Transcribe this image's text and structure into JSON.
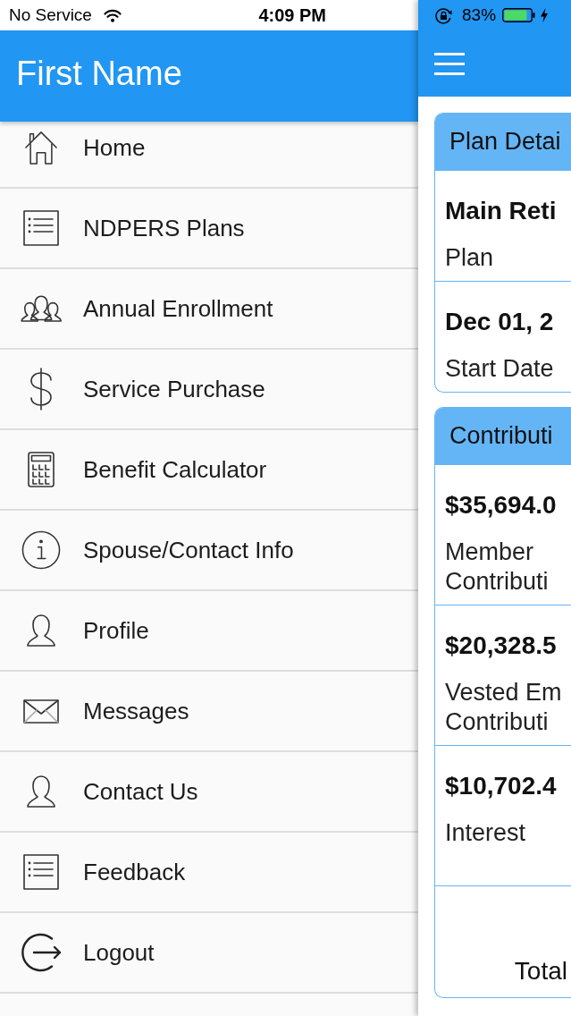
{
  "status_bar": {
    "carrier": "No Service",
    "time": "4:09 PM",
    "battery": "83%"
  },
  "drawer": {
    "title": "First Name",
    "items": [
      {
        "label": "Home",
        "kind": "home"
      },
      {
        "label": "NDPERS Plans",
        "kind": "list"
      },
      {
        "label": "Annual Enrollment",
        "kind": "people"
      },
      {
        "label": "Service Purchase",
        "kind": "dollar"
      },
      {
        "label": "Benefit Calculator",
        "kind": "calculator"
      },
      {
        "label": "Spouse/Contact Info",
        "kind": "info"
      },
      {
        "label": "Profile",
        "kind": "person"
      },
      {
        "label": "Messages",
        "kind": "envelope"
      },
      {
        "label": "Contact Us",
        "kind": "person"
      },
      {
        "label": "Feedback",
        "kind": "list"
      },
      {
        "label": "Logout",
        "kind": "logout"
      }
    ]
  },
  "main": {
    "cards": [
      {
        "title": "Plan Detai",
        "rows": [
          {
            "value": "Main Reti",
            "label": "Plan"
          },
          {
            "value": "Dec 01, 2",
            "label": "Start Date"
          }
        ]
      },
      {
        "title": "Contributi",
        "rows": [
          {
            "value": "$35,694.0",
            "label": "Member Contributi"
          },
          {
            "value": "$20,328.5",
            "label": "Vested Em Contributi"
          },
          {
            "value": "$10,702.4",
            "label": "Interest"
          }
        ],
        "total_label": "Total"
      }
    ]
  }
}
